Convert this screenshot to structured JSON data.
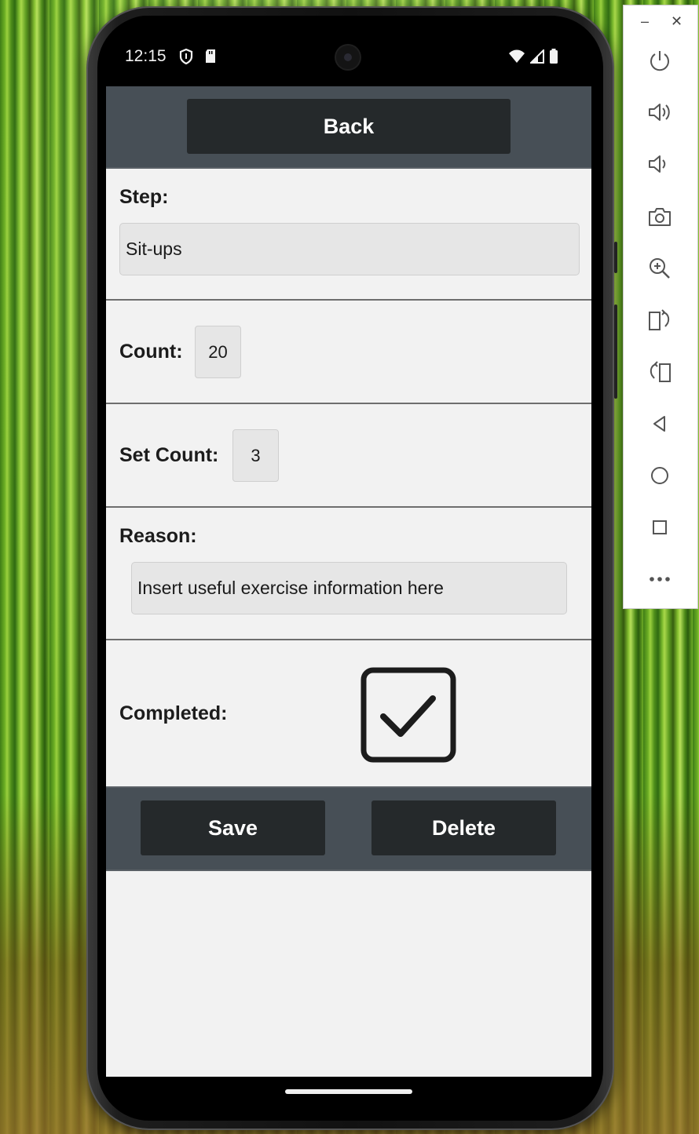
{
  "status_bar": {
    "time": "12:15"
  },
  "app": {
    "back_button": "Back",
    "step": {
      "label": "Step:",
      "value": "Sit-ups"
    },
    "count": {
      "label": "Count:",
      "value": "20"
    },
    "set_count": {
      "label": "Set Count:",
      "value": "3"
    },
    "reason": {
      "label": "Reason:",
      "value": "Insert useful exercise information here"
    },
    "completed": {
      "label": "Completed:",
      "checked": true
    },
    "save_button": "Save",
    "delete_button": "Delete"
  },
  "emulator_toolbar": {
    "minimize": "–",
    "close": "✕",
    "buttons": [
      "power-icon",
      "volume-up-icon",
      "volume-down-icon",
      "camera-icon",
      "zoom-icon",
      "rotate-left-icon",
      "rotate-right-icon",
      "back-icon",
      "home-icon",
      "overview-icon",
      "more-icon"
    ]
  },
  "colors": {
    "header_bar": "#474f56",
    "button_bg": "#25292b",
    "content_bg": "#f2f2f2",
    "input_bg": "#e6e6e6"
  }
}
